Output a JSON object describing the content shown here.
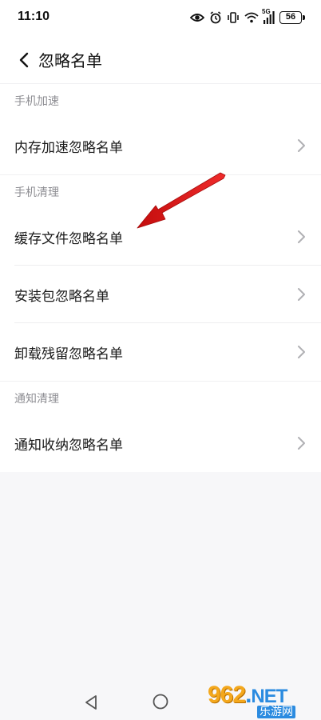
{
  "status_bar": {
    "time": "11:10",
    "network": "5G",
    "battery": "56",
    "icons": [
      "eye-icon",
      "alarm-icon",
      "vibrate-icon",
      "wifi-icon",
      "signal-icon",
      "battery-icon"
    ]
  },
  "header": {
    "back_icon": "chevron-left-icon",
    "title": "忽略名单"
  },
  "sections": [
    {
      "title": "手机加速",
      "items": [
        {
          "label": "内存加速忽略名单"
        }
      ]
    },
    {
      "title": "手机清理",
      "items": [
        {
          "label": "缓存文件忽略名单"
        },
        {
          "label": "安装包忽略名单"
        },
        {
          "label": "卸载残留忽略名单"
        }
      ]
    },
    {
      "title": "通知清理",
      "items": [
        {
          "label": "通知收纳忽略名单"
        }
      ]
    }
  ],
  "annotation": {
    "type": "arrow",
    "color": "#e02020"
  },
  "nav_bar": {
    "icons": [
      "back-triangle-icon",
      "home-circle-icon"
    ]
  },
  "watermark": {
    "top_text": "962",
    "dot": ".",
    "net": "NET",
    "bottom_text": "乐游网"
  },
  "colors": {
    "background": "#f7f7f9",
    "surface": "#ffffff",
    "section_text": "#8e8e93",
    "arrow": "#e02020"
  }
}
